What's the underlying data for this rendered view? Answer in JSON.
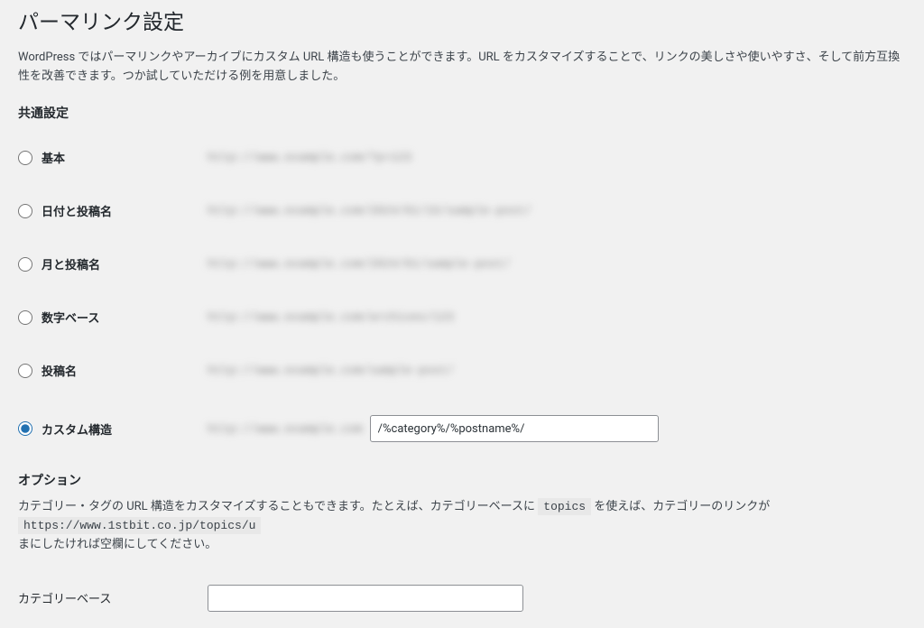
{
  "page": {
    "title": "パーマリンク設定",
    "description": "WordPress ではパーマリンクやアーカイブにカスタム URL 構造も使うことができます。URL をカスタマイズすることで、リンクの美しさや使いやすさ、そして前方互換性を改善できます。つか試していただける例を用意しました。"
  },
  "common": {
    "heading": "共通設定",
    "options": [
      {
        "id": "plain",
        "label": "基本",
        "example": "http://www.example.com/?p=123",
        "selected": false
      },
      {
        "id": "date_name",
        "label": "日付と投稿名",
        "example": "http://www.example.com/2024/01/15/sample-post/",
        "selected": false
      },
      {
        "id": "month_name",
        "label": "月と投稿名",
        "example": "http://www.example.com/2024/01/sample-post/",
        "selected": false
      },
      {
        "id": "numeric",
        "label": "数字ベース",
        "example": "http://www.example.com/archives/123",
        "selected": false
      },
      {
        "id": "postname",
        "label": "投稿名",
        "example": "http://www.example.com/sample-post/",
        "selected": false
      },
      {
        "id": "custom",
        "label": "カスタム構造",
        "example": "http://www.example.com",
        "selected": true
      }
    ],
    "custom_value": "/%category%/%postname%/"
  },
  "options": {
    "heading": "オプション",
    "desc_pre": "カテゴリー・タグの URL 構造をカスタマイズすることもできます。たとえば、カテゴリーベースに ",
    "desc_code1": "topics",
    "desc_mid": " を使えば、カテゴリーのリンクが ",
    "desc_code2": "https://www.1stbit.co.jp/topics/u",
    "desc_post": "まにしたければ空欄にしてください。",
    "category_base_label": "カテゴリーベース",
    "category_base_value": ""
  }
}
